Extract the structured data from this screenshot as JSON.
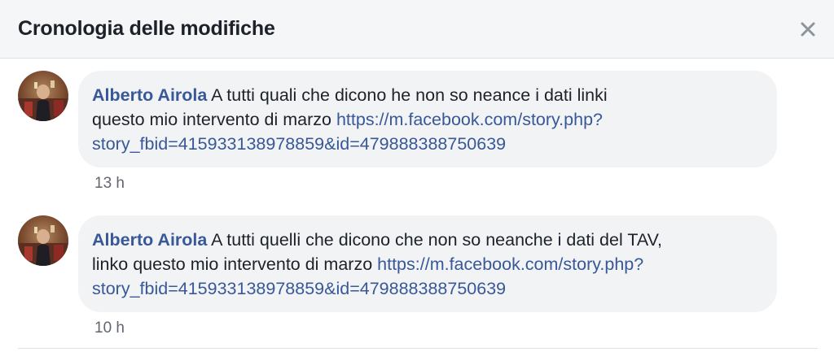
{
  "dialog": {
    "title": "Cronologia delle modifiche",
    "close_icon": "close-icon"
  },
  "entries": [
    {
      "author": "Alberto Airola",
      "text_line1": " A tutti quali che dicono he non so neance i dati linki",
      "text_line2": "questo mio intervento di marzo ",
      "link_line1": "https://m.facebook.com/story.php?",
      "link_line2": "story_fbid=415933138978859&id=479888388750639",
      "timestamp": "13 h"
    },
    {
      "author": "Alberto Airola",
      "text_line1": " A tutti quelli che dicono che non so neanche i dati del TAV,",
      "text_line2": "linko questo mio intervento di marzo ",
      "link_line1": "https://m.facebook.com/story.php?",
      "link_line2": "story_fbid=415933138978859&id=479888388750639",
      "timestamp": "10 h"
    }
  ],
  "colors": {
    "link": "#385898",
    "text": "#1d2129",
    "bubble": "#f2f3f5",
    "header_bg": "#f5f6f7",
    "meta": "#606770"
  }
}
